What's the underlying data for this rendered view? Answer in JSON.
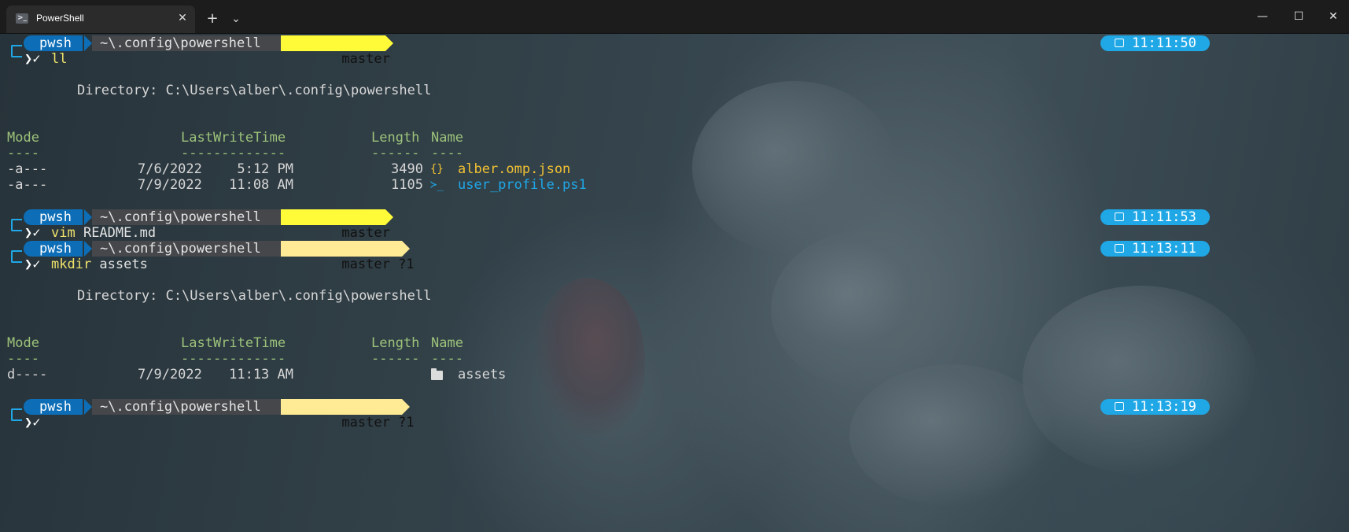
{
  "window": {
    "tab_title": "PowerShell",
    "tab_icon_glyph": ">_",
    "close_tab_glyph": "✕",
    "new_tab_glyph": "+",
    "dropdown_glyph": "⌄",
    "minimize_glyph": "—",
    "maximize_glyph": "☐",
    "close_glyph": "✕"
  },
  "prompts": [
    {
      "shell": "pwsh",
      "path": "~\\.config\\powershell",
      "branch": "master",
      "branch_icon": "",
      "time": "11:11:50",
      "symbol": "❯✓",
      "command": "ll",
      "args": ""
    },
    {
      "shell": "pwsh",
      "path": "~\\.config\\powershell",
      "branch": "master",
      "branch_icon": "",
      "time": "11:11:53",
      "symbol": "❯✓",
      "command": "vim",
      "args": " README.md"
    },
    {
      "shell": "pwsh",
      "path": "~\\.config\\powershell",
      "branch": "master ?1",
      "branch_icon": "",
      "time": "11:13:11",
      "symbol": "❯✓",
      "command": "mkdir",
      "args": " assets"
    },
    {
      "shell": "pwsh",
      "path": "~\\.config\\powershell",
      "branch": "master ?1",
      "branch_icon": "",
      "time": "11:13:19",
      "symbol": "❯✓",
      "command": "",
      "args": ""
    }
  ],
  "listings": [
    {
      "directory_line": "Directory: C:\\Users\\alber\\.config\\powershell",
      "header": {
        "mode": "Mode",
        "lastwrite": "LastWriteTime",
        "length": "Length",
        "name": "Name"
      },
      "divider": {
        "mode": "----",
        "lastwrite": "-------------",
        "length": "------",
        "name": "----"
      },
      "rows": [
        {
          "mode": "-a---",
          "date": "7/6/2022",
          "time": "5:12 PM",
          "length": "3490",
          "icon": "{}",
          "name": "alber.omp.json"
        },
        {
          "mode": "-a---",
          "date": "7/9/2022",
          "time": "11:08 AM",
          "length": "1105",
          "icon": "≻_",
          "name": "user_profile.ps1"
        }
      ]
    },
    {
      "directory_line": "Directory: C:\\Users\\alber\\.config\\powershell",
      "header": {
        "mode": "Mode",
        "lastwrite": "LastWriteTime",
        "length": "Length",
        "name": "Name"
      },
      "divider": {
        "mode": "----",
        "lastwrite": "-------------",
        "length": "------",
        "name": "----"
      },
      "rows": [
        {
          "mode": "d----",
          "date": "7/9/2022",
          "time": "11:13 AM",
          "length": "",
          "icon": "folder",
          "name": "assets"
        }
      ]
    }
  ],
  "colors": {
    "pwsh_segment": "#0d6eb7",
    "path_segment": "#45474a",
    "git_clean": "#fffb38",
    "git_dirty": "#ffeb95",
    "time_segment": "#1fa7e6",
    "header_green": "#9cc27a",
    "json_yellow": "#f1c232",
    "ps1_cyan": "#1fa7e6"
  }
}
